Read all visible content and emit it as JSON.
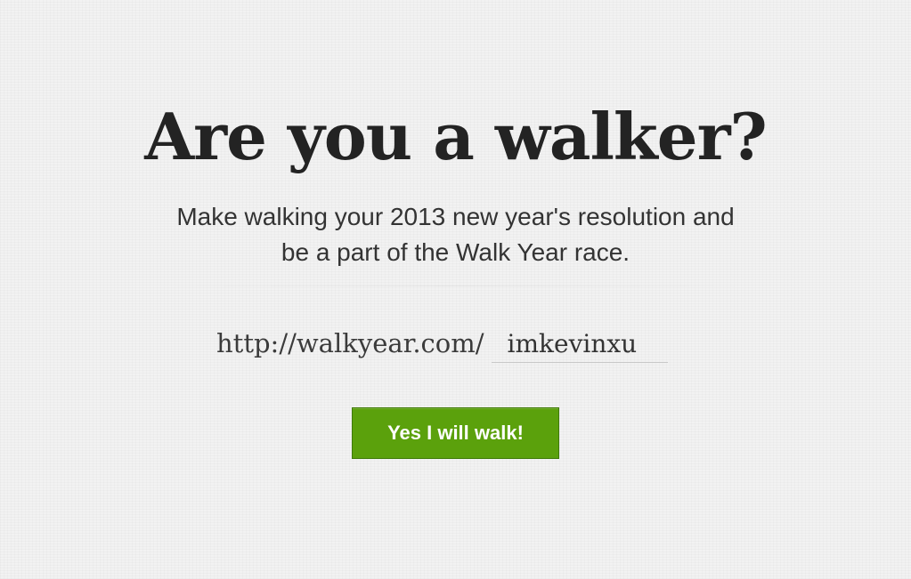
{
  "hero": {
    "title": "Are you a walker?",
    "subtitle_line1": "Make walking your 2013 new year's resolution and",
    "subtitle_line2": "be a part of the Walk Year race."
  },
  "signup": {
    "url_prefix": "http://walkyear.com/",
    "username_value": "imkevinxu",
    "submit_label": "Yes I will walk!"
  },
  "colors": {
    "background": "#f2f2f2",
    "title_text": "#232323",
    "button_green": "#5ba10c"
  }
}
